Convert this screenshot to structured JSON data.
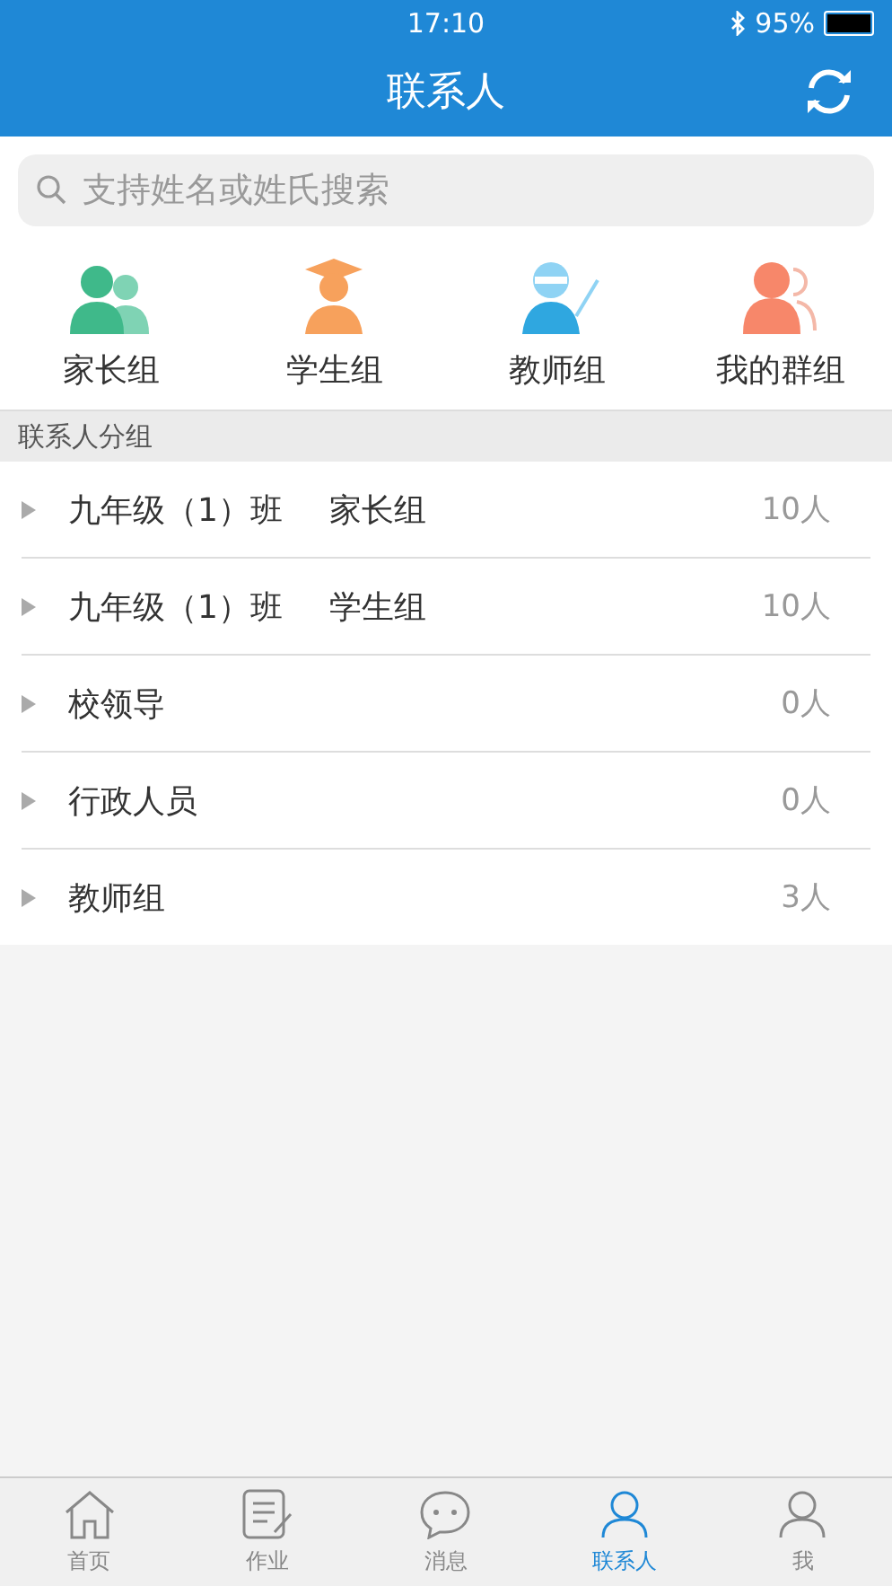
{
  "status_bar": {
    "time": "17:10",
    "battery": "95%"
  },
  "nav": {
    "title": "联系人"
  },
  "search": {
    "placeholder": "支持姓名或姓氏搜索"
  },
  "categories": [
    {
      "label": "家长组",
      "kind": "parents"
    },
    {
      "label": "学生组",
      "kind": "student"
    },
    {
      "label": "教师组",
      "kind": "teacher"
    },
    {
      "label": "我的群组",
      "kind": "group"
    }
  ],
  "section": {
    "title": "联系人分组"
  },
  "groups": [
    {
      "name": "九年级（1）班",
      "subgroup": "家长组",
      "count": "10人",
      "expanded": false
    },
    {
      "name": "九年级（1）班",
      "subgroup": "学生组",
      "count": "10人",
      "expanded": false
    },
    {
      "name": "校领导",
      "count": "0人",
      "expanded": false
    },
    {
      "name": "行政人员",
      "count": "0人",
      "expanded": false
    },
    {
      "name": "教师组",
      "count": "3人",
      "expanded": false
    }
  ],
  "tab_bar": [
    {
      "label": "首页",
      "kind": "home",
      "selected": false
    },
    {
      "label": "作业",
      "kind": "homework",
      "selected": false
    },
    {
      "label": "消息",
      "kind": "message",
      "selected": false
    },
    {
      "label": "联系人",
      "kind": "contacts",
      "selected": true
    },
    {
      "label": "我",
      "kind": "me",
      "selected": false
    }
  ]
}
